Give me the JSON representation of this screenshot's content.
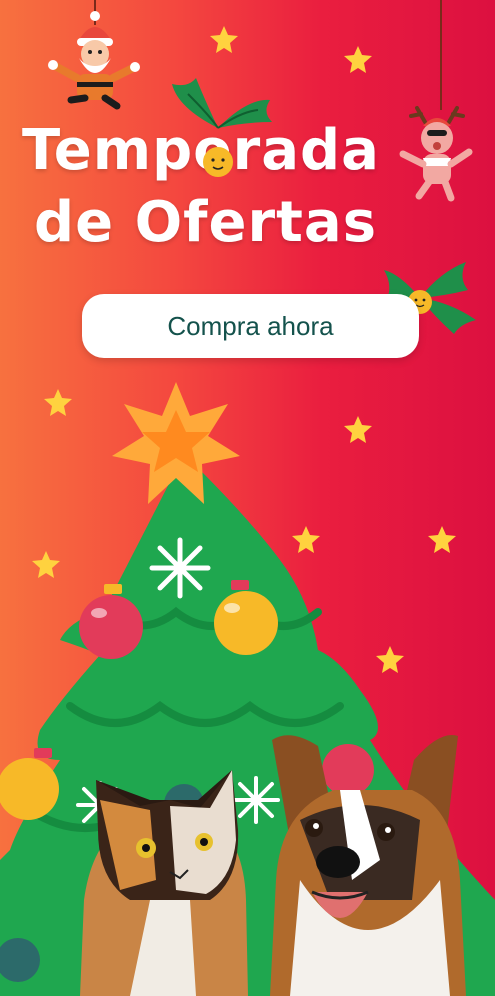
{
  "banner": {
    "title_line1": "Temporada",
    "title_line2": "de Ofertas",
    "cta_label": "Compra ahora"
  },
  "colors": {
    "gradient_left": "#f7713f",
    "gradient_right": "#dc1040",
    "tree_green": "#1fa74f",
    "star_yellow": "#ffd23f",
    "cta_text": "#14524c"
  }
}
